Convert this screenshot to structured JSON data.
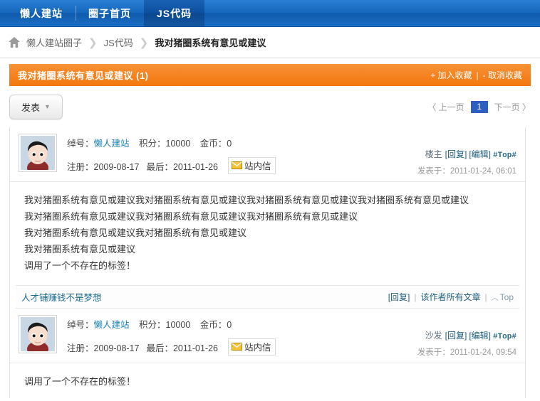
{
  "topnav": {
    "items": [
      {
        "label": "懒人建站",
        "active": false
      },
      {
        "label": "圈子首页",
        "active": false
      },
      {
        "label": "JS代码",
        "active": true
      }
    ]
  },
  "breadcrumb": {
    "home_icon": "home-icon",
    "items": [
      "懒人建站圈子",
      "JS代码",
      "我对猪圈系统有意见或建议"
    ],
    "separator": "❯"
  },
  "titlebar": {
    "title": "我对猪圈系统有意见或建议 (1)",
    "add_fav": "+ 加入收藏",
    "divider": "|",
    "remove_fav": "- 取消收藏",
    "bg_color": "#f5821f"
  },
  "toolbar": {
    "post_label": "发表",
    "post_caret": "▼",
    "pager": {
      "prev": "〈 上一页",
      "current_page": "1",
      "next": "下一页 〉",
      "active_color": "#2c5fc0"
    }
  },
  "posts": [
    {
      "avatar_alt": "user-avatar",
      "nick_label": "绰号：",
      "nick": "懒人建站",
      "points_label": "积分：",
      "points": "10000",
      "coins_label": "金币：",
      "coins": "0",
      "reg_label": "注册：",
      "reg_date": "2009-08-17",
      "last_label": "最后：",
      "last_date": "2011-01-26",
      "pm_label": "站内信",
      "pm_icon": "mail-icon",
      "floor": "楼主",
      "reply": "[回复]",
      "edit": "[编辑]",
      "topmark": "#Top#",
      "posted_label": "发表于：",
      "posted_at": "2011-01-24, 06:01",
      "body": [
        "我对猪圈系统有意见或建议我对猪圈系统有意见或建议我对猪圈系统有意见或建议我对猪圈系统有意见或建议",
        "我对猪圈系统有意见或建议我对猪圈系统有意见或建议我对猪圈系统有意见或建议",
        "我对猪圈系统有意见或建议我对猪圈系统有意见或建议",
        "我对猪圈系统有意见或建议",
        "调用了一个不存在的标签！"
      ],
      "signature": "人才铺赚钱不是梦想",
      "foot_reply": "[回复]",
      "foot_author": "该作者所有文章",
      "foot_top": "Top",
      "foot_top_caret": "︿"
    },
    {
      "avatar_alt": "user-avatar",
      "nick_label": "绰号：",
      "nick": "懒人建站",
      "points_label": "积分：",
      "points": "10000",
      "coins_label": "金币：",
      "coins": "0",
      "reg_label": "注册：",
      "reg_date": "2009-08-17",
      "last_label": "最后：",
      "last_date": "2011-01-26",
      "pm_label": "站内信",
      "pm_icon": "mail-icon",
      "floor": "沙发",
      "reply": "[回复]",
      "edit": "[编辑]",
      "topmark": "#Top#",
      "posted_label": "发表于：",
      "posted_at": "2011-01-24, 09:54",
      "body": [
        "调用了一个不存在的标签！"
      ]
    }
  ]
}
